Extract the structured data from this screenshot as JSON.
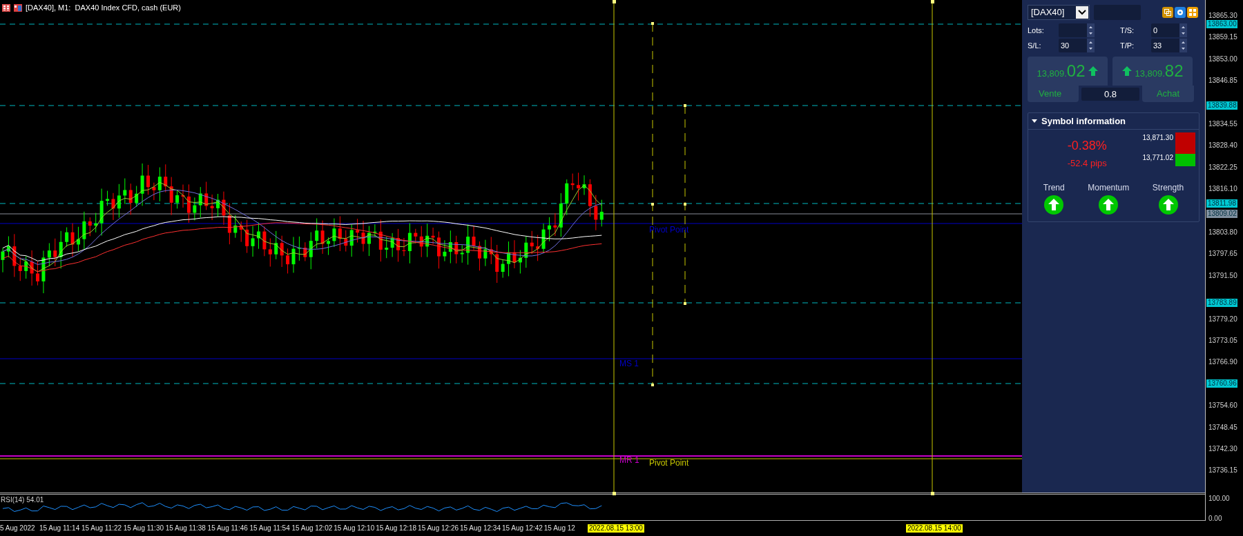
{
  "window": {
    "title": "[DAX40], M1:  DAX40 Index CFD, cash (EUR)"
  },
  "price_axis": {
    "ticks": [
      "13865.30",
      "13859.15",
      "13853.00",
      "13846.85",
      "13834.55",
      "13828.40",
      "13822.25",
      "13816.10",
      "13803.80",
      "13797.65",
      "13791.50",
      "13779.20",
      "13773.05",
      "13766.90",
      "13754.60",
      "13748.45",
      "13742.30",
      "13736.15"
    ],
    "labels": [
      {
        "text": "13863.00",
        "color": "#00c8d2"
      },
      {
        "text": "13839.88",
        "color": "#00c8d2"
      },
      {
        "text": "13811.98",
        "color": "#00c8d2"
      },
      {
        "text": "13809.02",
        "color": "#8090a0"
      },
      {
        "text": "13783.89",
        "color": "#00c8d2"
      },
      {
        "text": "13760.96",
        "color": "#00c8d2"
      }
    ]
  },
  "chart_labels": [
    {
      "text": "Pivot Point",
      "color": "#0000c8"
    },
    {
      "text": "MS 1",
      "color": "#0000c8"
    },
    {
      "text": "MR 1",
      "color": "#c800c8"
    },
    {
      "text": "Pivot Point",
      "color": "#c8c800"
    }
  ],
  "rsi": {
    "label": "RSI(14) 54.01",
    "ticks": [
      "100.00",
      "0.00"
    ]
  },
  "time_axis": {
    "labels": [
      "5 Aug 2022",
      "15 Aug 11:14",
      "15 Aug 11:22",
      "15 Aug 11:30",
      "15 Aug 11:38",
      "15 Aug 11:46",
      "15 Aug 11:54",
      "15 Aug 12:02",
      "15 Aug 12:10",
      "15 Aug 12:18",
      "15 Aug 12:26",
      "15 Aug 12:34",
      "15 Aug 12:42",
      "15 Aug 12"
    ],
    "markers": [
      "2022.08.15 13:00",
      "2022.08.15 14:00"
    ]
  },
  "panel": {
    "symbol": "[DAX40]",
    "lots": {
      "label": "Lots:"
    },
    "ts": {
      "label": "T/S:",
      "value": "0"
    },
    "sl": {
      "label": "S/L:",
      "value": "30"
    },
    "tp": {
      "label": "T/P:",
      "value": "33"
    },
    "sell": {
      "price_small": "13,809.",
      "price_big": "02",
      "label": "Vente"
    },
    "buy": {
      "price_small": "13,809.",
      "price_big": "82",
      "label": "Achat"
    },
    "spread": "0.8",
    "symbol_info": {
      "title": "Symbol information",
      "expanded": true,
      "change": "-0.38%",
      "pips": "-52.4 pips",
      "high": "13,871.30",
      "low": "13,771.02",
      "indicators": [
        {
          "label": "Trend",
          "kind": "up"
        },
        {
          "label": "Momentum",
          "kind": "up"
        },
        {
          "label": "Strength",
          "kind": "up"
        }
      ]
    }
  }
}
